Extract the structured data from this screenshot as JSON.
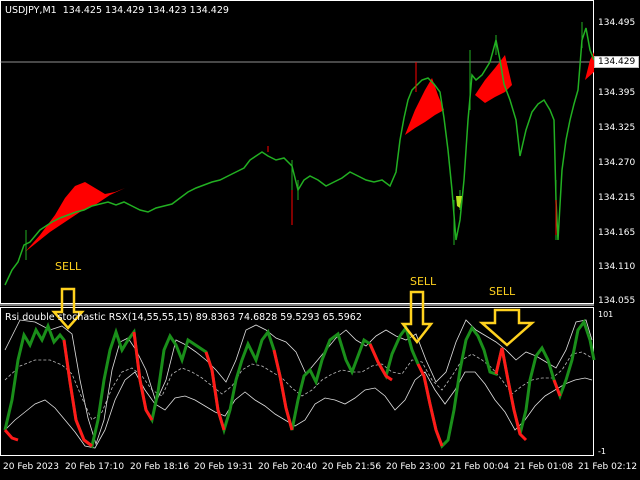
{
  "header": {
    "symbol_timeframe": "USDJPY,M1",
    "ohlc": "134.425 134.429 134.423 134.429"
  },
  "price_axis": {
    "labels": [
      "134.495",
      "134.395",
      "134.325",
      "134.270",
      "134.215",
      "134.165",
      "134.110",
      "134.055"
    ],
    "current": "134.429"
  },
  "indicator": {
    "title": "Rsi double stochastic RSX(14,55,55,15) 89.8363 74.6828 59.5293 65.5962",
    "axis_top": "101",
    "axis_bottom": "-1"
  },
  "time_axis": {
    "labels": [
      "20 Feb 2023",
      "20 Feb 17:10",
      "20 Feb 18:16",
      "20 Feb 19:31",
      "20 Feb 20:40",
      "20 Feb 21:56",
      "20 Feb 23:00",
      "21 Feb 00:04",
      "21 Feb 01:08",
      "21 Feb 02:12"
    ]
  },
  "annotations": {
    "sell_1": "SELL",
    "sell_2": "SELL",
    "sell_3": "SELL"
  },
  "colors": {
    "background": "#000000",
    "bull": "#22b022",
    "bear": "#ff0000",
    "arrow": "#ffd21f",
    "rsx_up": "#1a8f1a",
    "rsx_down": "#ff1a1a",
    "grid": "#ffffff"
  },
  "icons": {
    "sell_arrow": "arrow-down-icon"
  }
}
